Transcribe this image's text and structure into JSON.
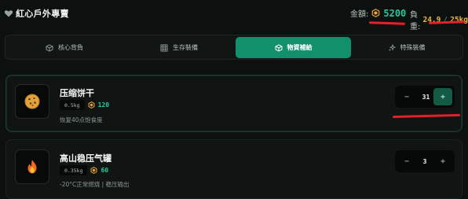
{
  "header": {
    "title": "紅心戶外專賣",
    "gold_label": "金額:",
    "gold_value": "5200",
    "load_label": "負重:",
    "load_current": "24.9",
    "load_sep": "/",
    "load_max": "25kg"
  },
  "tabs": [
    {
      "label": "核心背負",
      "icon": "cube-outline-icon",
      "active": false
    },
    {
      "label": "生存裝備",
      "icon": "grid-icon",
      "active": false
    },
    {
      "label": "物資補給",
      "icon": "box-icon",
      "active": true
    },
    {
      "label": "特殊裝備",
      "icon": "sparkle-icon",
      "active": false
    }
  ],
  "items": [
    {
      "name": "压缩饼干",
      "weight": "0.5kg",
      "price": "120",
      "description": "恢复40点饱食度",
      "quantity": "31",
      "icon": "cookie-icon"
    },
    {
      "name": "高山稳压气罐",
      "weight": "0.35kg",
      "price": "60",
      "description": "-20°C正常燃烧 | 稳压输出",
      "quantity": "3",
      "icon": "fire-icon"
    }
  ],
  "stepper": {
    "minus": "−",
    "plus": "+"
  },
  "colors": {
    "accent": "#12906c",
    "price": "#2bc89b",
    "load": "#e8b73a",
    "annotation": "#e0202a"
  }
}
